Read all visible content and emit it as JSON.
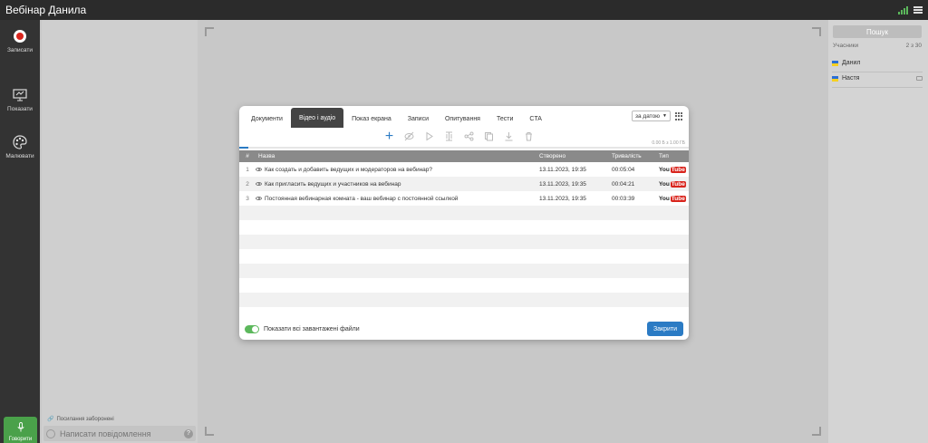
{
  "window": {
    "title": "Вебінар Данила"
  },
  "leftbar": {
    "record_label": "Записати",
    "show_label": "Показати",
    "draw_label": "Малювати",
    "speak_label": "Говорити"
  },
  "chat": {
    "banned_notice": "Посилання заборонені",
    "input_placeholder": "Написати повідомлення"
  },
  "participants": {
    "search_label": "Пошук",
    "header_label": "Учасники",
    "count": "2 з 30",
    "items": [
      {
        "name": "Данил"
      },
      {
        "name": "Настя"
      }
    ]
  },
  "modal": {
    "tabs": [
      {
        "label": "Документи"
      },
      {
        "label": "Відео і аудіо"
      },
      {
        "label": "Показ екрана"
      },
      {
        "label": "Записи"
      },
      {
        "label": "Опитування"
      },
      {
        "label": "Тести"
      },
      {
        "label": "CTA"
      }
    ],
    "active_tab_index": 1,
    "sort": {
      "selected": "за датою"
    },
    "storage": "0.00 Б з 1.00 ГБ",
    "storage_used_fraction": 0.02,
    "table": {
      "headers": {
        "num": "#",
        "name": "Назва",
        "created": "Створено",
        "duration": "Тривалість",
        "type": "Тип"
      },
      "rows": [
        {
          "num": "1",
          "name": "Как создать и добавить ведущих и модераторов на вебинар?",
          "created": "13.11.2023, 19:35",
          "duration": "00:05:04",
          "type_you": "You",
          "type_tube": "Tube"
        },
        {
          "num": "2",
          "name": "Как пригласить ведущих и участников на вебинар",
          "created": "13.11.2023, 19:35",
          "duration": "00:04:21",
          "type_you": "You",
          "type_tube": "Tube"
        },
        {
          "num": "3",
          "name": "Постоянная вебинарная комната - ваш вебинар с постоянной ссылкой",
          "created": "13.11.2023, 19:35",
          "duration": "00:03:39",
          "type_you": "You",
          "type_tube": "Tube"
        }
      ]
    },
    "show_all_label": "Показати всі завантажені файли",
    "close_label": "Закрити"
  },
  "colors": {
    "accent": "#2b7bc4",
    "record": "#d9251d",
    "speak": "#4aa14a",
    "toggle": "#5cb85c"
  }
}
